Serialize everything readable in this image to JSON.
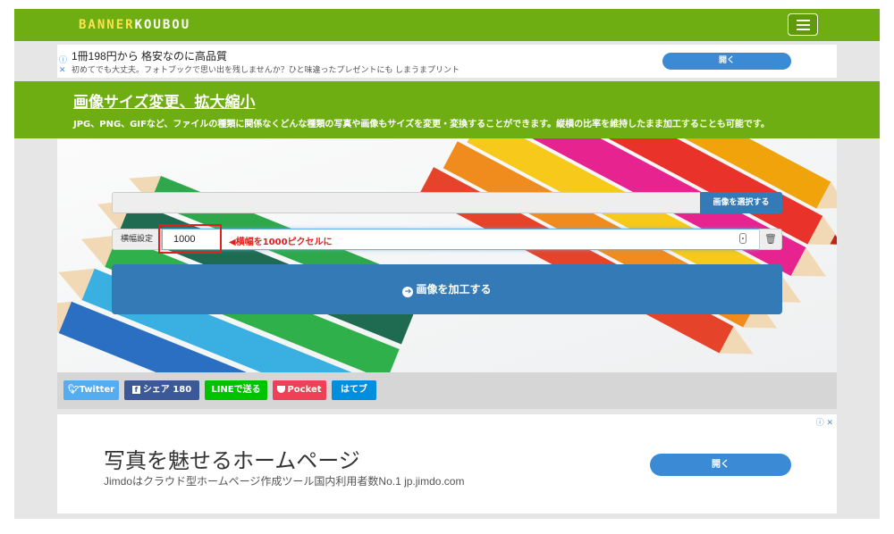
{
  "header": {
    "logo_part1": "BANNER",
    "logo_part2": "KOUBOU",
    "menu_icon": "hamburger-icon",
    "colors": {
      "bar": "#6fae12",
      "logo_accent": "#ffe14d"
    }
  },
  "ad_top": {
    "info_icon": "ⓘ",
    "close_icon": "✕",
    "title": "1冊198円から 格安なのに高品質",
    "subtitle": "初めてでも大丈夫。フォトブックで思い出を残しませんか？ひと味違ったプレゼントにも しまうまプリント",
    "button": "開く"
  },
  "title_band": {
    "title": "画像サイズ変更、拡大縮小",
    "description": "JPG、PNG、GIFなど、ファイルの種類に関係なくどんな種類の写真や画像もサイズを変更・変換することができます。縦横の比率を維持したまま加工することも可能です。"
  },
  "tool": {
    "select_button": "画像を選択する",
    "width_label": "横幅設定",
    "width_value": "1000",
    "hint": "◀横幅を1000ピクセルに",
    "trash_icon": "🗑",
    "process_icon": "➔",
    "process_button": "画像を加工する",
    "colors": {
      "primary": "#337ab7",
      "highlight": "#e0201c"
    }
  },
  "share": {
    "twitter": "Twitter",
    "twitter_icon": "twitter-bird-icon",
    "facebook": "シェア 180",
    "facebook_icon": "facebook-icon",
    "line": "LINEで送る",
    "pocket": "Pocket",
    "pocket_icon": "pocket-icon",
    "hatena": "はてブ",
    "colors": {
      "twitter": "#55acee",
      "facebook": "#3b5998",
      "line": "#00c300",
      "pocket": "#ee4056",
      "hatena": "#008fde"
    }
  },
  "ad_bottom": {
    "corner": "ⓘ ✕",
    "title": "写真を魅せるホームページ",
    "subtitle": "Jimdoはクラウド型ホームページ作成ツール国内利用者数No.1 jp.jimdo.com",
    "button": "開く"
  }
}
